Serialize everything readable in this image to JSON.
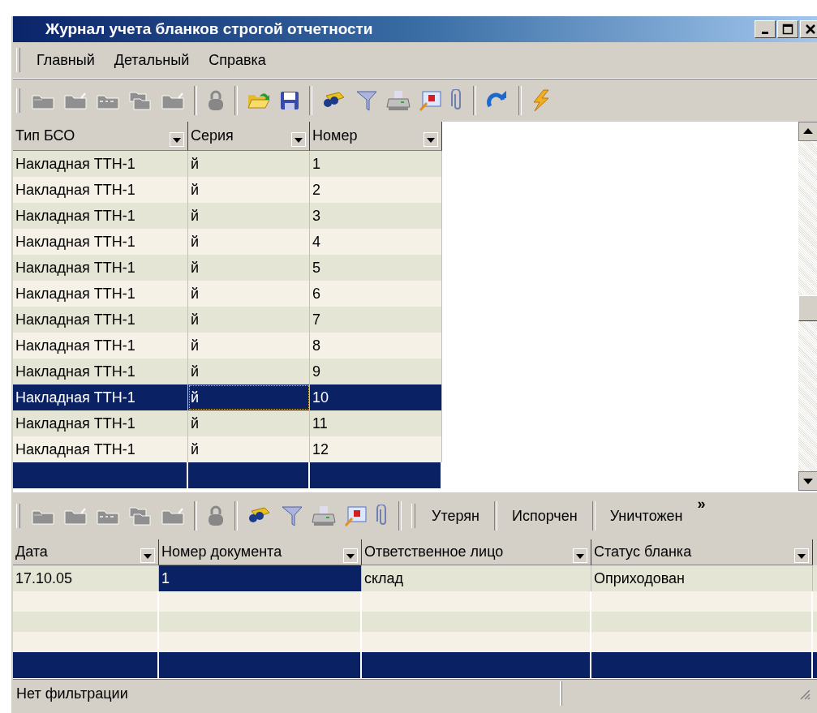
{
  "window": {
    "title": "Журнал учета бланков строгой отчетности"
  },
  "menu": [
    {
      "label": "Главный"
    },
    {
      "label": "Детальный"
    },
    {
      "label": "Справка"
    }
  ],
  "toolbar": {
    "groups": [
      {
        "buttons": [
          {
            "kind": "folder",
            "disabled": true
          },
          {
            "kind": "folder-up",
            "disabled": true
          },
          {
            "kind": "folder-dots",
            "disabled": true
          },
          {
            "kind": "folders",
            "disabled": true
          },
          {
            "kind": "folder-up",
            "disabled": true
          }
        ]
      },
      {
        "buttons": [
          {
            "kind": "lock",
            "disabled": true
          }
        ]
      },
      {
        "buttons": [
          {
            "kind": "open",
            "disabled": false
          },
          {
            "kind": "save",
            "disabled": false
          }
        ]
      },
      {
        "buttons": [
          {
            "kind": "binoculars",
            "disabled": false
          },
          {
            "kind": "filter",
            "disabled": false
          },
          {
            "kind": "printer",
            "disabled": false
          },
          {
            "kind": "report",
            "disabled": false
          },
          {
            "kind": "clip",
            "disabled": false
          }
        ]
      },
      {
        "buttons": [
          {
            "kind": "refresh",
            "disabled": false
          }
        ]
      },
      {
        "buttons": [
          {
            "kind": "bolt",
            "disabled": false
          }
        ]
      }
    ]
  },
  "grid": {
    "columns": [
      "Тип БСО",
      "Серия",
      "Номер"
    ],
    "rows": [
      {
        "selected": false,
        "cells": [
          "Накладная ТТН-1",
          "й",
          "1"
        ]
      },
      {
        "selected": false,
        "cells": [
          "Накладная ТТН-1",
          "й",
          "2"
        ]
      },
      {
        "selected": false,
        "cells": [
          "Накладная ТТН-1",
          "й",
          "3"
        ]
      },
      {
        "selected": false,
        "cells": [
          "Накладная ТТН-1",
          "й",
          "4"
        ]
      },
      {
        "selected": false,
        "cells": [
          "Накладная ТТН-1",
          "й",
          "5"
        ]
      },
      {
        "selected": false,
        "cells": [
          "Накладная ТТН-1",
          "й",
          "6"
        ]
      },
      {
        "selected": false,
        "cells": [
          "Накладная ТТН-1",
          "й",
          "7"
        ]
      },
      {
        "selected": false,
        "cells": [
          "Накладная ТТН-1",
          "й",
          "8"
        ]
      },
      {
        "selected": false,
        "cells": [
          "Накладная ТТН-1",
          "й",
          "9"
        ]
      },
      {
        "selected": true,
        "cells": [
          "Накладная ТТН-1",
          {
            "text": "й",
            "focused": true
          },
          "10"
        ]
      },
      {
        "selected": false,
        "cells": [
          "Накладная ТТН-1",
          "й",
          "11"
        ]
      },
      {
        "selected": false,
        "cells": [
          "Накладная ТТН-1",
          "й",
          "12"
        ]
      }
    ]
  },
  "detail_toolbar": {
    "groups": [
      {
        "buttons": [
          {
            "kind": "folder",
            "disabled": true
          },
          {
            "kind": "folder-up",
            "disabled": true
          },
          {
            "kind": "folder-dots",
            "disabled": true
          },
          {
            "kind": "folders",
            "disabled": true
          },
          {
            "kind": "folder-up",
            "disabled": true
          }
        ]
      },
      {
        "buttons": [
          {
            "kind": "lock",
            "disabled": true
          }
        ]
      },
      {
        "buttons": [
          {
            "kind": "binoculars",
            "disabled": false
          },
          {
            "kind": "filter",
            "disabled": false
          },
          {
            "kind": "printer",
            "disabled": false
          },
          {
            "kind": "report",
            "disabled": false
          },
          {
            "kind": "clip",
            "disabled": false
          }
        ]
      }
    ],
    "buttons": [
      "Утерян",
      "Испорчен",
      "Уничтожен"
    ],
    "overflow": "»"
  },
  "detail_grid": {
    "columns": [
      "Дата",
      "Номер документа",
      "Ответственное лицо",
      "Статус бланка"
    ],
    "rows": [
      {
        "cells": [
          "17.10.05",
          {
            "text": "1",
            "selected": true
          },
          "склад",
          "Оприходован"
        ]
      }
    ]
  },
  "status_bar": [
    "Нет фильтрации"
  ]
}
